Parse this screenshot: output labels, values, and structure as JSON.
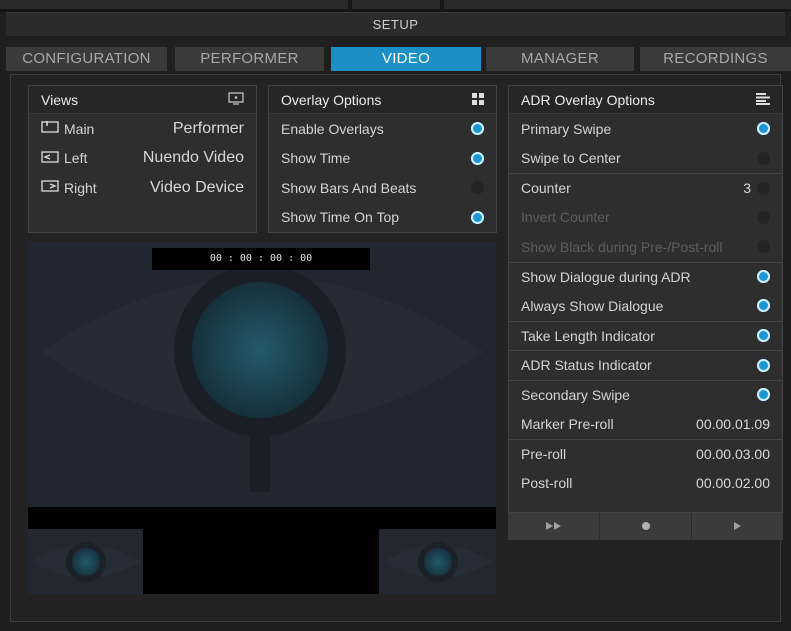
{
  "window": {
    "title": "SETUP"
  },
  "tabs": [
    {
      "label": "CONFIGURATION",
      "active": false
    },
    {
      "label": "PERFORMER",
      "active": false
    },
    {
      "label": "VIDEO",
      "active": true
    },
    {
      "label": "MANAGER",
      "active": false
    },
    {
      "label": "RECORDINGS",
      "active": false
    }
  ],
  "views": {
    "title": "Views",
    "header_icon": "monitor-icon",
    "rows": [
      {
        "label": "Main",
        "icon": "main-screen-icon",
        "source": "Performer"
      },
      {
        "label": "Left",
        "icon": "left-screen-icon",
        "source": "Nuendo Video"
      },
      {
        "label": "Right",
        "icon": "right-screen-icon",
        "source": "Video Device"
      }
    ]
  },
  "overlay": {
    "title": "Overlay Options",
    "header_icon": "grid-icon",
    "rows": [
      {
        "label": "Enable Overlays",
        "on": true
      },
      {
        "label": "Show Time",
        "on": true
      },
      {
        "label": "Show Bars And Beats",
        "on": false
      },
      {
        "label": "Show Time On Top",
        "on": true
      }
    ]
  },
  "adr": {
    "title": "ADR Overlay Options",
    "header_icon": "list-icon",
    "rows": [
      {
        "label": "Primary Swipe",
        "on": true
      },
      {
        "label": "Swipe to Center",
        "on": false
      },
      {
        "label": "Counter",
        "value": "3",
        "on": false
      },
      {
        "label": "Invert Counter",
        "on": false,
        "dim": true
      },
      {
        "label": "Show Black during Pre-/Post-roll",
        "on": false,
        "dim": true
      },
      {
        "label": "Show Dialogue during ADR",
        "on": true
      },
      {
        "label": "Always Show Dialogue",
        "on": true
      },
      {
        "label": "Take Length Indicator",
        "on": true
      },
      {
        "label": "ADR Status Indicator",
        "on": true
      },
      {
        "label": "Secondary Swipe",
        "on": true
      },
      {
        "label": "Marker Pre-roll",
        "value": "00.00.01.09"
      },
      {
        "label": "Pre-roll",
        "value": "00.00.03.00"
      },
      {
        "label": "Post-roll",
        "value": "00.00.02.00"
      }
    ],
    "buttons": [
      {
        "icon": "fast-forward-icon",
        "glyph": "▶︎▶︎"
      },
      {
        "icon": "record-icon",
        "glyph": "●"
      },
      {
        "icon": "play-icon",
        "glyph": "▶"
      }
    ]
  },
  "video": {
    "timecode": "00 : 00 : 00 : 00"
  },
  "colors": {
    "accent": "#1d8fc7",
    "background": "#1f1f1f",
    "panel": "#2e2e2e"
  }
}
